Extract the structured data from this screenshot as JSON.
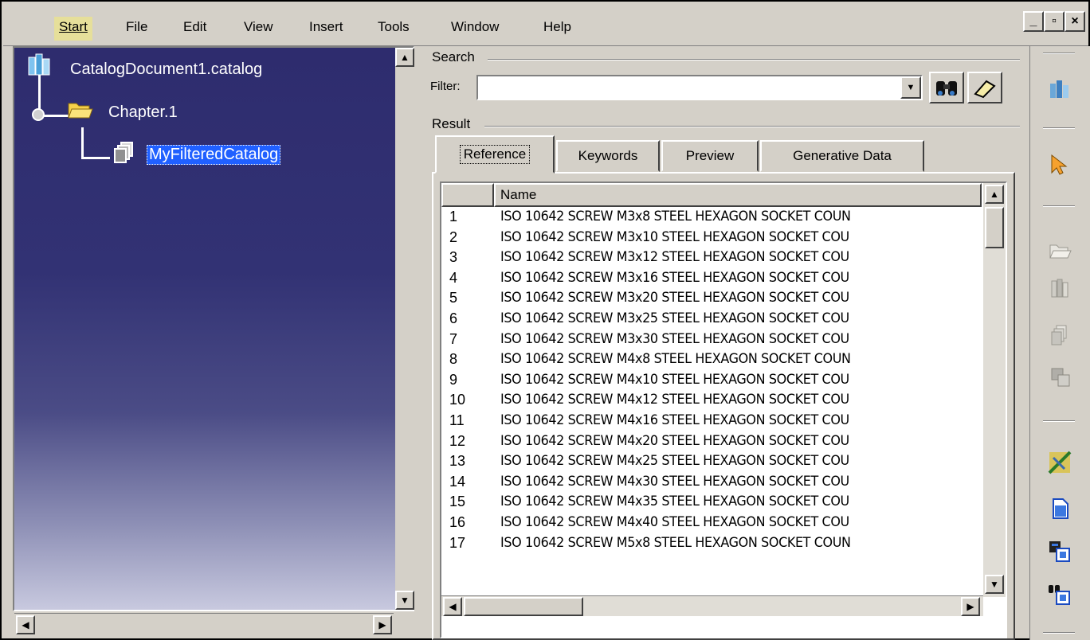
{
  "menu": {
    "items": [
      {
        "label": "Start"
      },
      {
        "label": "File"
      },
      {
        "label": "Edit"
      },
      {
        "label": "View"
      },
      {
        "label": "Insert"
      },
      {
        "label": "Tools"
      },
      {
        "label": "Window"
      },
      {
        "label": "Help"
      }
    ]
  },
  "window_controls": {
    "minimize": "_",
    "restore": "▫",
    "close": "×"
  },
  "tree": {
    "root": "CatalogDocument1.catalog",
    "chapter": "Chapter.1",
    "selected": "MyFilteredCatalog"
  },
  "search": {
    "group_label": "Search",
    "filter_label": "Filter:",
    "filter_value": ""
  },
  "result": {
    "group_label": "Result",
    "tabs": [
      {
        "label": "Reference"
      },
      {
        "label": "Keywords"
      },
      {
        "label": "Preview"
      },
      {
        "label": "Generative Data"
      }
    ],
    "active_tab": "Reference",
    "column_header": "Name",
    "rows": [
      {
        "num": "1",
        "name": "ISO 10642 SCREW M3x8 STEEL HEXAGON SOCKET COUN"
      },
      {
        "num": "2",
        "name": "ISO 10642 SCREW M3x10 STEEL HEXAGON SOCKET COU"
      },
      {
        "num": "3",
        "name": "ISO 10642 SCREW M3x12 STEEL HEXAGON SOCKET COU"
      },
      {
        "num": "4",
        "name": "ISO 10642 SCREW M3x16 STEEL HEXAGON SOCKET COU"
      },
      {
        "num": "5",
        "name": "ISO 10642 SCREW M3x20 STEEL HEXAGON SOCKET COU"
      },
      {
        "num": "6",
        "name": "ISO 10642 SCREW M3x25 STEEL HEXAGON SOCKET COU"
      },
      {
        "num": "7",
        "name": "ISO 10642 SCREW M3x30 STEEL HEXAGON SOCKET COU"
      },
      {
        "num": "8",
        "name": "ISO 10642 SCREW M4x8 STEEL HEXAGON SOCKET COUN"
      },
      {
        "num": "9",
        "name": "ISO 10642 SCREW M4x10 STEEL HEXAGON SOCKET COU"
      },
      {
        "num": "10",
        "name": "ISO 10642 SCREW M4x12 STEEL HEXAGON SOCKET COU"
      },
      {
        "num": "11",
        "name": "ISO 10642 SCREW M4x16 STEEL HEXAGON SOCKET COU"
      },
      {
        "num": "12",
        "name": "ISO 10642 SCREW M4x20 STEEL HEXAGON SOCKET COU"
      },
      {
        "num": "13",
        "name": "ISO 10642 SCREW M4x25 STEEL HEXAGON SOCKET COU"
      },
      {
        "num": "14",
        "name": "ISO 10642 SCREW M4x30 STEEL HEXAGON SOCKET COU"
      },
      {
        "num": "15",
        "name": "ISO 10642 SCREW M4x35 STEEL HEXAGON SOCKET COU"
      },
      {
        "num": "16",
        "name": "ISO 10642 SCREW M4x40 STEEL HEXAGON SOCKET COU"
      },
      {
        "num": "17",
        "name": "ISO 10642 SCREW M5x8 STEEL HEXAGON SOCKET COUN"
      }
    ]
  },
  "toolbar": {
    "icons": [
      "catalog-browser-icon",
      "select-arrow-icon",
      "open-folder-icon",
      "chapter-icon",
      "family-icon",
      "part-family-icon",
      "generate-icon",
      "add-document-icon",
      "add-component-icon",
      "add-query-icon"
    ]
  },
  "colors": {
    "tree_bg_top": "#2e2c6e",
    "tree_bg_bottom": "#c8c9df",
    "selection": "#2060ff",
    "chrome": "#d4d0c8",
    "menu_active": "#e6df9a"
  }
}
